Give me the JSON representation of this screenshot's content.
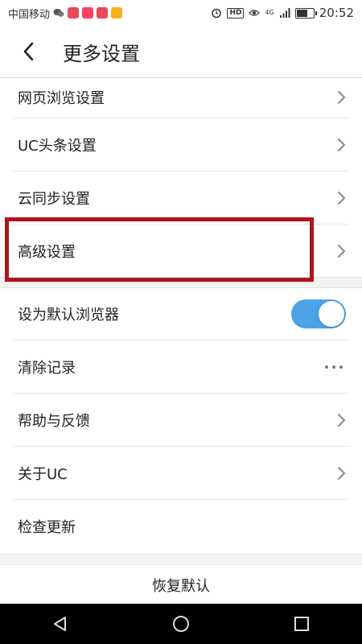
{
  "status_bar": {
    "carrier": "中国移动",
    "time": "20:52",
    "hd_label": "HD",
    "network_label": "4G",
    "battery_level": 0.7
  },
  "header": {
    "title": "更多设置",
    "back_icon": "chevron-left-icon"
  },
  "settings": {
    "web_browsing": "网页浏览设置",
    "uc_headlines": "UC头条设置",
    "cloud_sync": "云同步设置",
    "advanced": "高级设置",
    "default_browser": "设为默认浏览器",
    "default_browser_enabled": true,
    "clear_history": "清除记录",
    "help_feedback": "帮助与反馈",
    "about_uc": "关于UC",
    "check_update": "检查更新"
  },
  "restore_defaults": "恢复默认",
  "colors": {
    "toggle_on": "#4aa3e8",
    "highlight": "#b0121c"
  },
  "navbar": {
    "back_icon": "triangle-back-icon",
    "home_icon": "circle-home-icon",
    "recents_icon": "square-recents-icon"
  }
}
